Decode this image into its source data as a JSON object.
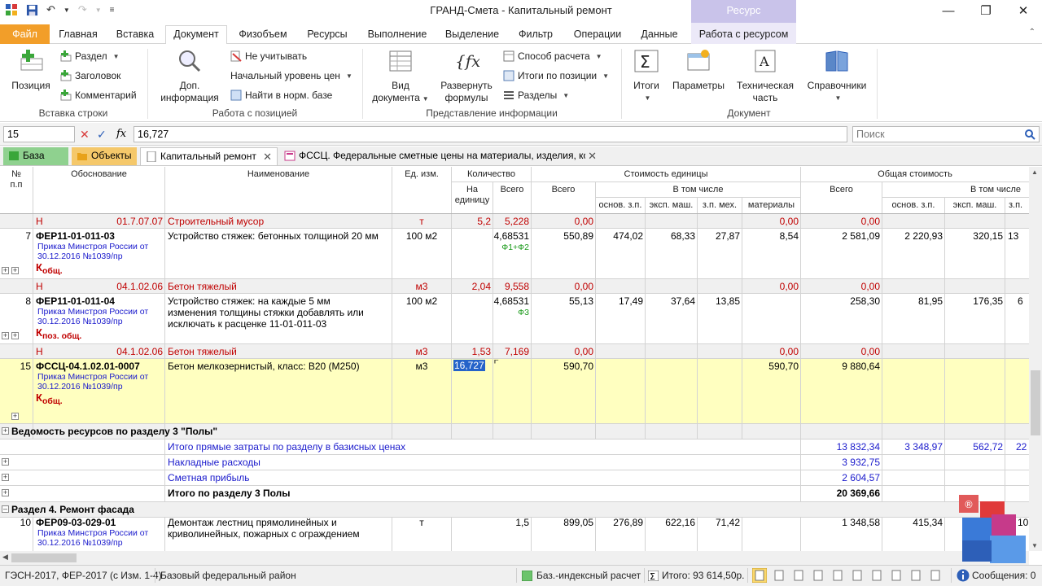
{
  "window": {
    "title": "ГРАНД-Смета - Капитальный ремонт",
    "context_group": "Ресурс"
  },
  "tabs": [
    "Файл",
    "Главная",
    "Вставка",
    "Документ",
    "Физобъем",
    "Ресурсы",
    "Выполнение",
    "Выделение",
    "Фильтр",
    "Операции",
    "Данные",
    "Работа с ресурсом"
  ],
  "ribbon": {
    "position": "Позиция",
    "section": "Раздел",
    "heading": "Заголовок",
    "comment": "Комментарий",
    "group_insert": "Вставка строки",
    "dop1": "Доп.",
    "dop2": "информация",
    "ignore": "Не учитывать",
    "start_level": "Начальный уровень цен",
    "find_norm": "Найти в норм. базе",
    "group_position": "Работа с позицией",
    "view1": "Вид",
    "view2": "документа",
    "expand1": "Развернуть",
    "expand2": "формулы",
    "calc_method": "Способ расчета",
    "totals_pos": "Итоги по позиции",
    "sections": "Разделы",
    "group_info": "Представление информации",
    "totals": "Итоги",
    "params": "Параметры",
    "tech1": "Техническая",
    "tech2": "часть",
    "refs": "Справочники",
    "group_doc": "Документ"
  },
  "formula_bar": {
    "cell_ref": "15",
    "value": "16,727",
    "search_placeholder": "Поиск"
  },
  "doc_tabs": {
    "base": "База",
    "objects": "Объекты",
    "current": "Капитальный ремонт",
    "fssc": "ФССЦ. Федеральные сметные цены на материалы, изделия, ко"
  },
  "headers": {
    "num1": "№",
    "num2": "п.п",
    "basis": "Обоснование",
    "name": "Наименование",
    "unit": "Ед. изм.",
    "qty": "Количество",
    "qty_unit1": "На",
    "qty_unit2": "единицу",
    "qty_total": "Всего",
    "unit_cost": "Стоимость единицы",
    "uc_total": "Всего",
    "incl": "В том числе",
    "osn_zp": "основ. з.п.",
    "eksp": "эксп. маш.",
    "zp_meh": "з.п. мех.",
    "materials": "материалы",
    "total_cost": "Общая стоимость",
    "tc_total": "Всего",
    "tc_incl": "В том числе",
    "tc_osn": "основ. з.п.",
    "tc_eksp": "эксп. маш.",
    "tc_zp": "з.п."
  },
  "rows": {
    "r1": {
      "type": "Н",
      "code": "01.7.07.07",
      "name": "Строительный мусор",
      "unit": "т",
      "q1": "5,2",
      "q2": "5,228",
      "uc": "0,00",
      "mat": "0,00",
      "tc": "0,00"
    },
    "r2": {
      "num": "7",
      "code": "ФЕР11-01-011-03",
      "order1": "Приказ Минстроя России от",
      "order2": "30.12.2016 №1039/пр",
      "k": "К",
      "ksub": "общ.",
      "name": "Устройство стяжек: бетонных толщиной 20 мм",
      "unit": "100 м2",
      "q2": "4,68531",
      "formula": "Ф1+Ф2",
      "uc": "550,89",
      "osn": "474,02",
      "eksp": "68,33",
      "zpm": "27,87",
      "mat": "8,54",
      "tc": "2 581,09",
      "tc_osn": "2 220,93",
      "tc_eksp": "320,15",
      "tc_zp": "13"
    },
    "r3": {
      "type": "Н",
      "code": "04.1.02.06",
      "name": "Бетон тяжелый",
      "unit": "м3",
      "q1": "2,04",
      "q2": "9,558",
      "uc": "0,00",
      "mat": "0,00",
      "tc": "0,00"
    },
    "r4": {
      "num": "8",
      "code": "ФЕР11-01-011-04",
      "order1": "Приказ Минстроя России от",
      "order2": "30.12.2016 №1039/пр",
      "k": "К",
      "ksub": "поз. общ.",
      "name1": "Устройство стяжек: на каждые 5 мм",
      "name2": "изменения толщины стяжки добавлять или",
      "name3": "исключать к расценке 11-01-011-03",
      "unit": "100 м2",
      "q2": "4,68531",
      "formula": "Ф3",
      "uc": "55,13",
      "osn": "17,49",
      "eksp": "37,64",
      "zpm": "13,85",
      "tc": "258,30",
      "tc_osn": "81,95",
      "tc_eksp": "176,35",
      "tc_zp": "6"
    },
    "r5": {
      "type": "Н",
      "code": "04.1.02.06",
      "name": "Бетон тяжелый",
      "unit": "м3",
      "q1": "1,53",
      "q2": "7,169",
      "uc": "0,00",
      "mat": "0,00",
      "tc": "0,00"
    },
    "r6": {
      "num": "15",
      "code": "ФССЦ-04.1.02.01-0007",
      "order1": "Приказ Минстроя России от",
      "order2": "30.12.2016 №1039/пр",
      "k": "К",
      "ksub": "общ.",
      "name": "Бетон мелкозернистый, класс: В20 (М250)",
      "unit": "м3",
      "q1": "16,727",
      "uc": "590,70",
      "mat": "590,70",
      "tc": "9 880,64"
    },
    "r7": {
      "title": "Ведомость ресурсов по разделу 3 \"Полы\""
    },
    "r8": {
      "name": "Итого прямые затраты по разделу в базисных ценах",
      "tc": "13 832,34",
      "tc_osn": "3 348,97",
      "tc_eksp": "562,72",
      "tc_zp": "22"
    },
    "r9": {
      "name": "Накладные расходы",
      "tc": "3 932,75"
    },
    "r10": {
      "name": "Сметная прибыль",
      "tc": "2 604,57"
    },
    "r11": {
      "name": "Итого по разделу 3 Полы",
      "tc": "20 369,66"
    },
    "r12": {
      "title": "Раздел 4. Ремонт фасада"
    },
    "r13": {
      "num": "10",
      "code": "ФЕР09-03-029-01",
      "order1": "Приказ Минстроя России от",
      "order2": "30.12.2016 №1039/пр",
      "name1": "Демонтаж лестниц прямолинейных и",
      "name2": "криволинейных, пожарных с ограждением",
      "unit": "т",
      "q2": "1,5",
      "uc": "899,05",
      "osn": "276,89",
      "eksp": "622,16",
      "zpm": "71,42",
      "tc": "1 348,58",
      "tc_osn": "415,34",
      "tc_zp": "10"
    }
  },
  "status": {
    "base": "ГЭСН-2017, ФЕР-2017 (с Изм. 1-4)",
    "region": "Базовый федеральный район",
    "calc": "Баз.-индексный расчет",
    "total": "Итого: 93 614,50р.",
    "messages": "Сообщения: 0"
  },
  "colors": {
    "file_tab": "#f29e29",
    "context": "#c9c3ea",
    "selected_row": "#ffffc0",
    "resource_row": "#f0f0f0",
    "link_blue": "#1a1acc",
    "red": "#c00000"
  }
}
